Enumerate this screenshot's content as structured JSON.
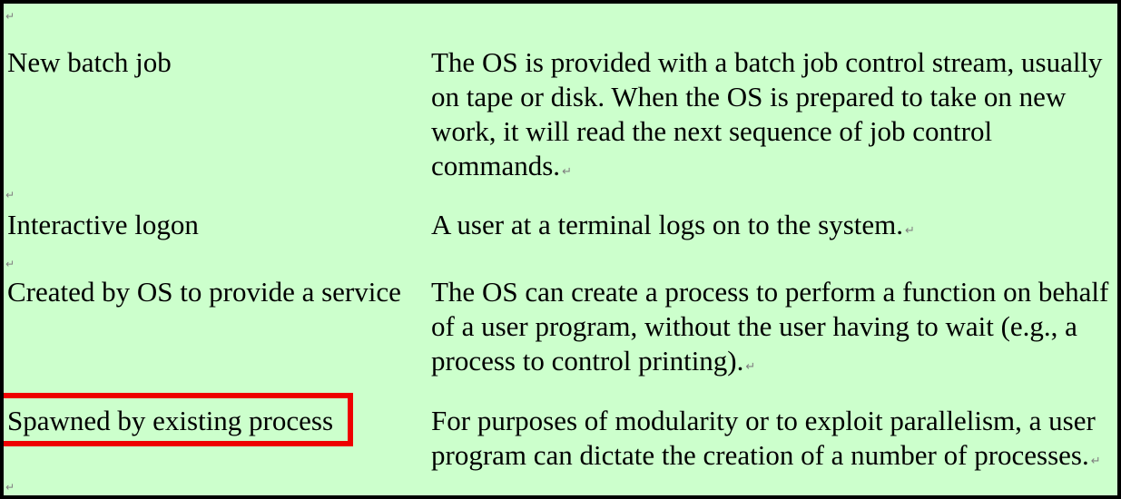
{
  "table": {
    "rows": [
      {
        "term": "New batch job",
        "description": "The OS is provided with a batch job control stream, usually on tape or disk. When the OS is prepared to take on new work, it will read the next sequence of job control commands."
      },
      {
        "term": "Interactive logon",
        "description": "A user at a terminal logs on to the system."
      },
      {
        "term": "Created by OS to provide a service",
        "description": "The OS can create a process to perform a function on behalf of a user program, without the user having to wait (e.g., a process to control printing)."
      },
      {
        "term": "Spawned by existing process",
        "description": "For purposes of modularity or to exploit parallelism, a user program can dictate the creation of a number of processes."
      }
    ]
  },
  "paragraph_mark": "↵",
  "colors": {
    "background": "#ccffcc",
    "border": "#000000",
    "highlight": "#ee0000"
  }
}
